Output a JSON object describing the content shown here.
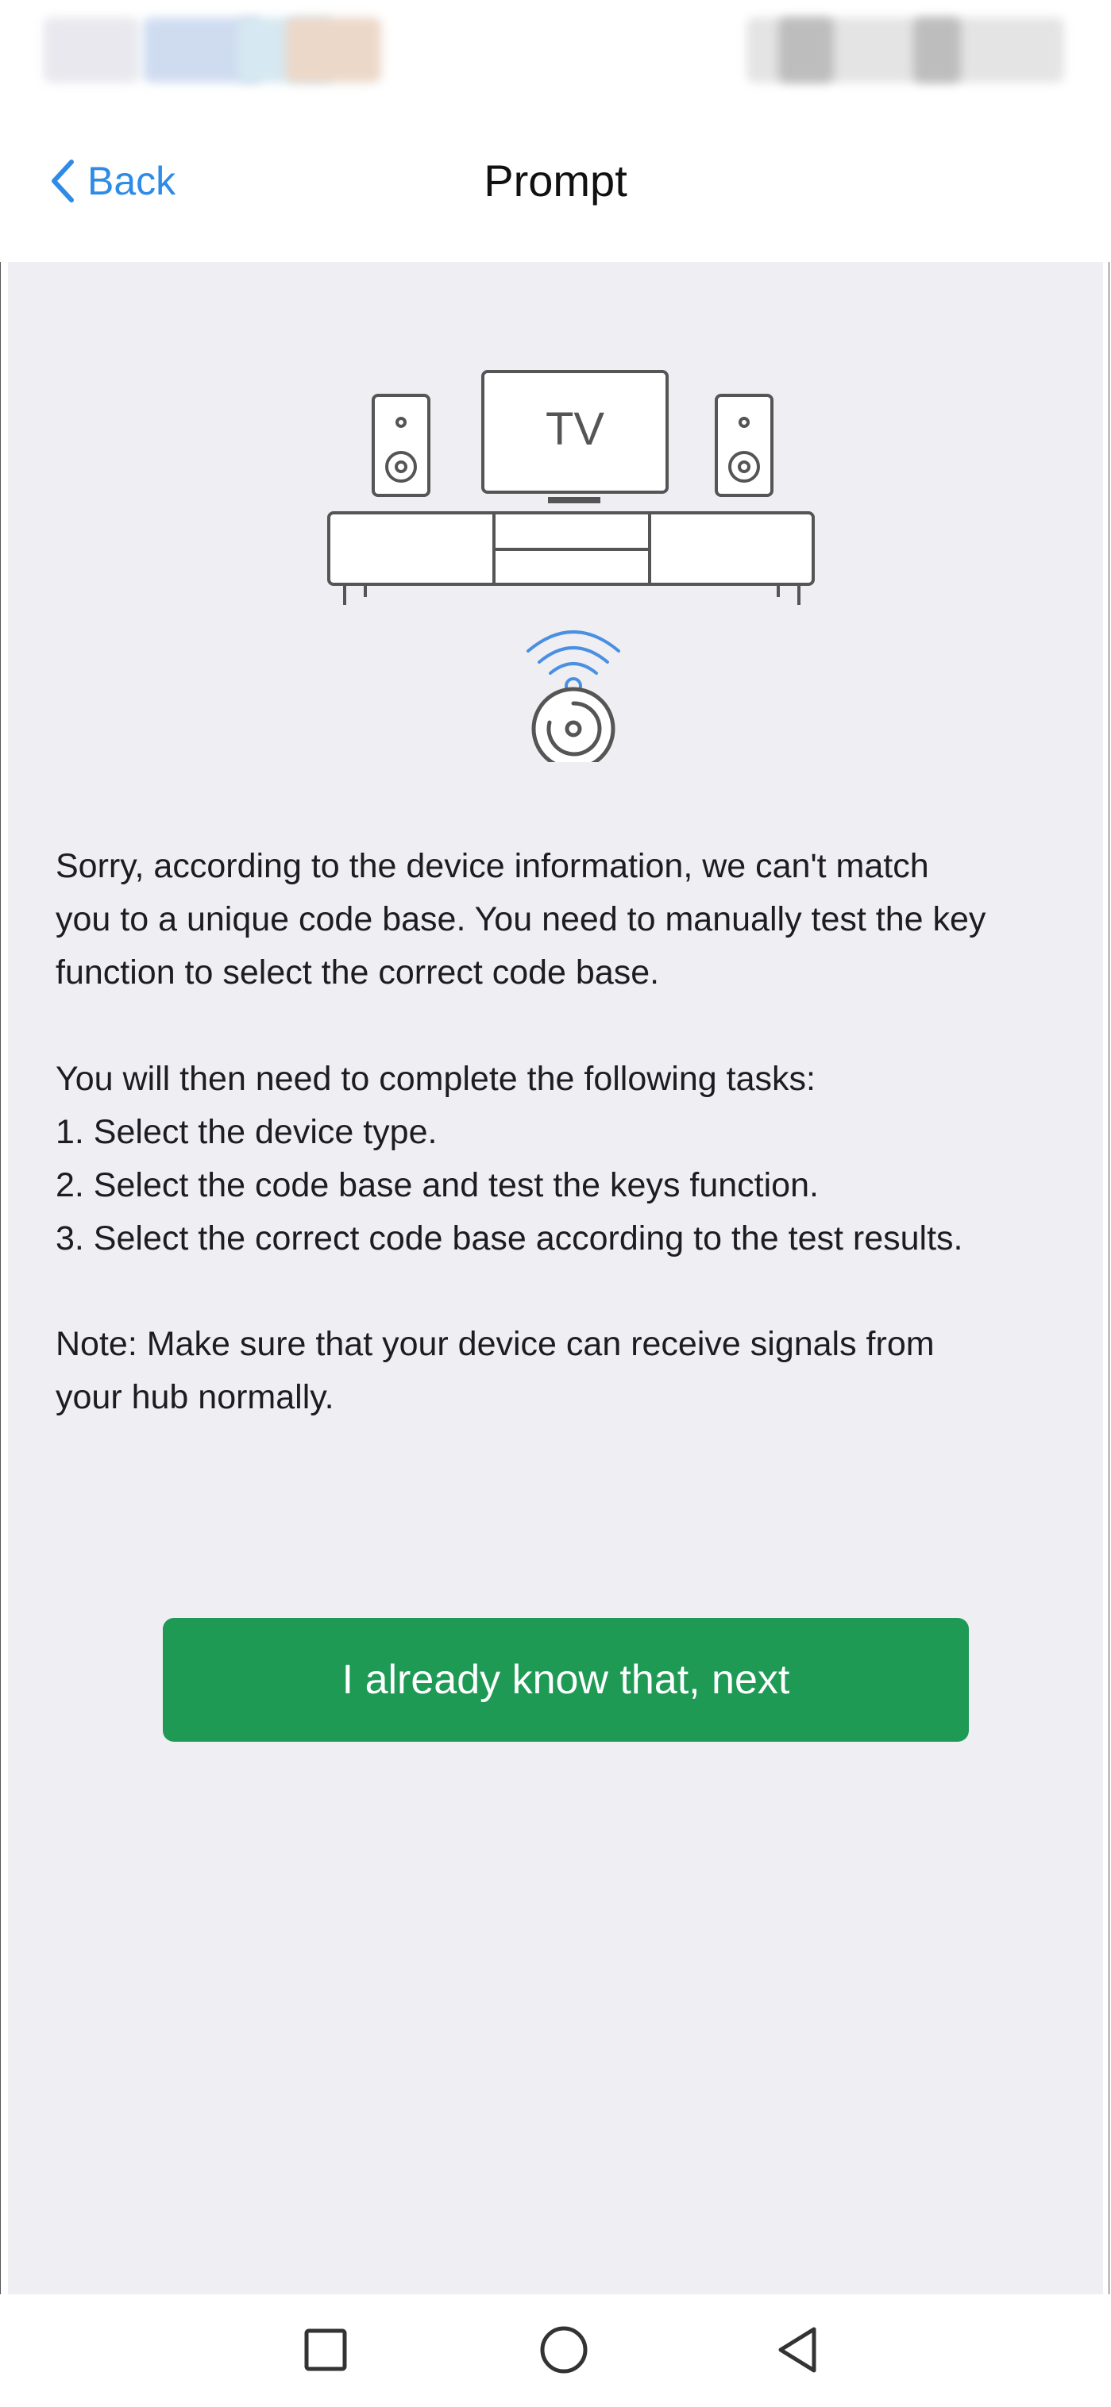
{
  "nav": {
    "back_label": "Back",
    "title": "Prompt"
  },
  "illustration": {
    "tv_label": "TV",
    "accent_color": "#4a90e2"
  },
  "content": {
    "paragraph1": [
      "Sorry, according to the device information, we can't match",
      "you to a unique code base. You need to manually test the key",
      "function to select the correct code base."
    ],
    "paragraph2": [
      "You will then need to complete the following tasks:",
      "1. Select the device type.",
      "2. Select the code base and test the keys function.",
      "3. Select the correct code base according to the test results."
    ],
    "paragraph3": [
      "Note: Make sure that your device can receive signals from",
      "your hub normally."
    ]
  },
  "button": {
    "label": "I already know that, next",
    "color": "#1e9a55"
  },
  "system_nav": {
    "icons": [
      "recents-icon",
      "home-icon",
      "back-icon"
    ]
  }
}
